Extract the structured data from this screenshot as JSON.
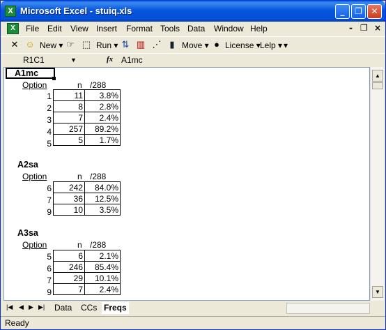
{
  "window": {
    "title": "Microsoft Excel - stuiq.xls",
    "app_icon": "X"
  },
  "menu": [
    "File",
    "Edit",
    "View",
    "Insert",
    "Format",
    "Tools",
    "Data",
    "Window",
    "Help"
  ],
  "toolbar": {
    "new_label": "New",
    "run_label": "Run",
    "move_label": "Move",
    "license_label": "License",
    "lelp_label": "Lelp"
  },
  "formula_bar": {
    "name_box": "R1C1",
    "fx": "fx",
    "formula": "A1mc"
  },
  "sheet": {
    "questions": [
      {
        "title": "A1mc",
        "header": {
          "option": "Option",
          "n": "n",
          "pct": "/288"
        },
        "rows": [
          [
            "1",
            "11",
            "3.8%"
          ],
          [
            "2",
            "8",
            "2.8%"
          ],
          [
            "3",
            "7",
            "2.4%"
          ],
          [
            "4",
            "257",
            "89.2%"
          ],
          [
            "5",
            "5",
            "1.7%"
          ]
        ]
      },
      {
        "title": "A2sa",
        "header": {
          "option": "Option",
          "n": "n",
          "pct": "/288"
        },
        "rows": [
          [
            "6",
            "242",
            "84.0%"
          ],
          [
            "7",
            "36",
            "12.5%"
          ],
          [
            "9",
            "10",
            "3.5%"
          ]
        ]
      },
      {
        "title": "A3sa",
        "header": {
          "option": "Option",
          "n": "n",
          "pct": "/288"
        },
        "rows": [
          [
            "5",
            "6",
            "2.1%"
          ],
          [
            "6",
            "246",
            "85.4%"
          ],
          [
            "7",
            "29",
            "10.1%"
          ],
          [
            "9",
            "7",
            "2.4%"
          ]
        ]
      }
    ]
  },
  "tabs": [
    "Data",
    "CCs",
    "Freqs"
  ],
  "active_tab": "Freqs",
  "status": "Ready",
  "colors": {
    "title_bar": "#0856DE",
    "chrome": "#ECE9D8",
    "excel_green": "#1E8B3A"
  }
}
